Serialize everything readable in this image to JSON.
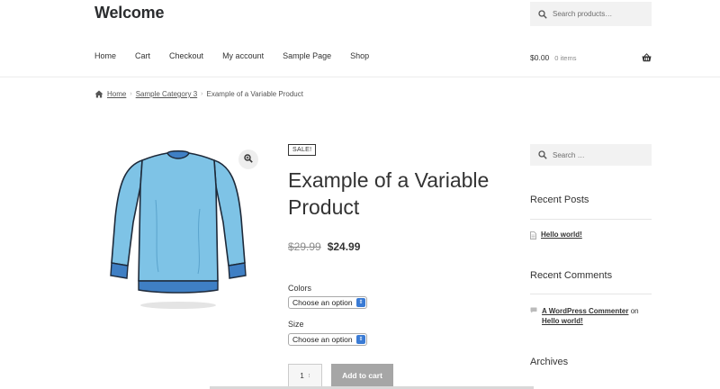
{
  "site": {
    "title": "Welcome"
  },
  "header_search": {
    "placeholder": "Search products…",
    "icon": "search-icon"
  },
  "nav": {
    "items": [
      {
        "label": "Home"
      },
      {
        "label": "Cart"
      },
      {
        "label": "Checkout"
      },
      {
        "label": "My account"
      },
      {
        "label": "Sample Page"
      },
      {
        "label": "Shop"
      }
    ]
  },
  "cart": {
    "amount": "$0.00",
    "count": "0 items",
    "icon": "basket-icon"
  },
  "breadcrumb": {
    "home": "Home",
    "category": "Sample Category 3",
    "current": "Example of a Variable Product"
  },
  "product": {
    "badge": "SALE!",
    "title": "Example of a Variable Product",
    "old_price": "$29.99",
    "new_price": "$24.99",
    "variations": [
      {
        "label": "Colors",
        "selected": "Choose an option"
      },
      {
        "label": "Size",
        "selected": "Choose an option"
      }
    ],
    "quantity": "1",
    "add_to_cart": "Add to cart",
    "colors": {
      "shirt": "#7ec3e6",
      "cuff": "#3f7fc4",
      "outline": "#1e2a3a"
    }
  },
  "sidebar": {
    "search_placeholder": "Search …",
    "recent_posts": {
      "title": "Recent Posts",
      "items": [
        "Hello world!"
      ]
    },
    "recent_comments": {
      "title": "Recent Comments",
      "author": "A WordPress Commenter",
      "on": "on",
      "post": "Hello world!"
    },
    "archives": {
      "title": "Archives"
    }
  }
}
